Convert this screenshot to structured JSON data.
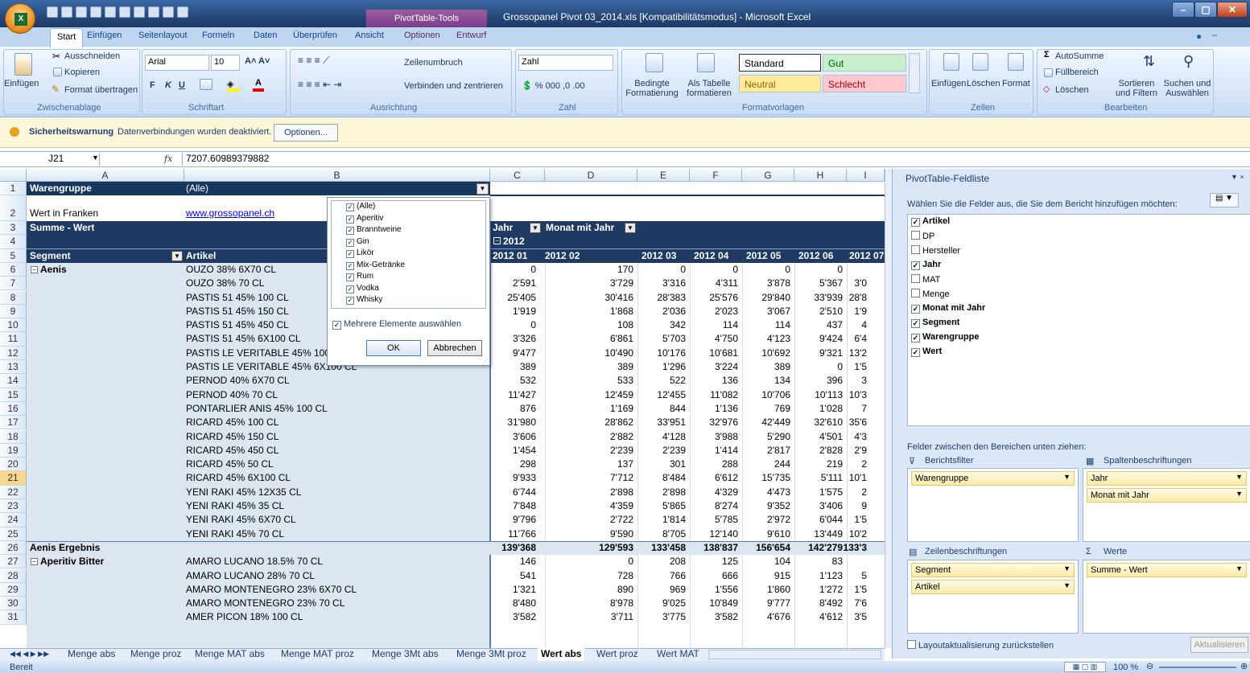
{
  "window": {
    "title": "Grossopanel Pivot 03_2014.xls  [Kompatibilitätsmodus] - Microsoft Excel",
    "context_tab": "PivotTable-Tools"
  },
  "tabs": [
    "Start",
    "Einfügen",
    "Seitenlayout",
    "Formeln",
    "Daten",
    "Überprüfen",
    "Ansicht",
    "Optionen",
    "Entwurf"
  ],
  "ribbon": {
    "clipboard": {
      "paste": "Einfügen",
      "cut": "Ausschneiden",
      "copy": "Kopieren",
      "format_painter": "Format übertragen",
      "label": "Zwischenablage"
    },
    "font": {
      "name": "Arial",
      "size": "10",
      "label": "Schriftart"
    },
    "alignment": {
      "wrap": "Zeilenumbruch",
      "merge": "Verbinden und zentrieren",
      "label": "Ausrichtung"
    },
    "number": {
      "format": "Zahl",
      "label": "Zahl"
    },
    "styles": {
      "conditional": "Bedingte Formatierung",
      "as_table": "Als Tabelle formatieren",
      "standard": "Standard",
      "good": "Gut",
      "neutral": "Neutral",
      "bad": "Schlecht",
      "label": "Formatvorlagen"
    },
    "cells": {
      "insert": "Einfügen",
      "delete": "Löschen",
      "format": "Format",
      "label": "Zellen"
    },
    "editing": {
      "autosum": "AutoSumme",
      "fill": "Füllbereich",
      "clear": "Löschen",
      "sort": "Sortieren und Filtern",
      "find": "Suchen und Auswählen",
      "label": "Bearbeiten"
    }
  },
  "security": {
    "title": "Sicherheitswarnung",
    "text": "Datenverbindungen wurden deaktiviert.",
    "button": "Optionen..."
  },
  "formula_bar": {
    "cell_ref": "J21",
    "fx": "fx",
    "value": "7207.60989379882"
  },
  "columns": [
    "A",
    "B",
    "C",
    "D",
    "E",
    "F",
    "G",
    "H",
    "I"
  ],
  "header_rows": {
    "r1": {
      "a": "Warengruppe",
      "b": "(Alle)"
    },
    "r2": {
      "a": "Wert in Franken",
      "b": "www.grossopanel.ch"
    },
    "r3": {
      "a": "Summe - Wert",
      "c": "Jahr",
      "d": "Monat mit Jahr"
    },
    "r4": {
      "c": "2012"
    },
    "r5": {
      "a": "Segment",
      "b": "Artikel",
      "months": [
        "2012 01",
        "2012 02",
        "2012 03",
        "2012 04",
        "2012 05",
        "2012 06",
        "2012 07"
      ]
    }
  },
  "rows": [
    {
      "n": "6",
      "seg": "Aenis",
      "art": "OUZO 38% 6X70 CL",
      "v": [
        "0",
        "170",
        "0",
        "0",
        "0",
        "0",
        ""
      ]
    },
    {
      "n": "7",
      "seg": "",
      "art": "OUZO 38% 70 CL",
      "v": [
        "2'591",
        "3'729",
        "3'316",
        "4'311",
        "3'878",
        "5'367",
        "3'0"
      ]
    },
    {
      "n": "8",
      "seg": "",
      "art": "PASTIS 51 45% 100 CL",
      "v": [
        "25'405",
        "30'416",
        "28'383",
        "25'576",
        "29'840",
        "33'939",
        "28'8"
      ]
    },
    {
      "n": "9",
      "seg": "",
      "art": "PASTIS 51 45% 150 CL",
      "v": [
        "1'919",
        "1'868",
        "2'036",
        "2'023",
        "3'067",
        "2'510",
        "1'9"
      ]
    },
    {
      "n": "10",
      "seg": "",
      "art": "PASTIS 51 45% 450 CL",
      "v": [
        "0",
        "108",
        "342",
        "114",
        "114",
        "437",
        "4"
      ]
    },
    {
      "n": "11",
      "seg": "",
      "art": "PASTIS 51 45% 6X100 CL",
      "v": [
        "3'326",
        "6'861",
        "5'703",
        "4'750",
        "4'123",
        "9'424",
        "6'4"
      ]
    },
    {
      "n": "12",
      "seg": "",
      "art": "PASTIS LE VERITABLE 45% 100 CL",
      "v": [
        "9'477",
        "10'490",
        "10'176",
        "10'681",
        "10'692",
        "9'321",
        "13'2"
      ]
    },
    {
      "n": "13",
      "seg": "",
      "art": "PASTIS LE VERITABLE 45% 6X100 CL",
      "v": [
        "389",
        "389",
        "1'296",
        "3'224",
        "389",
        "0",
        "1'5"
      ]
    },
    {
      "n": "14",
      "seg": "",
      "art": "PERNOD 40% 6X70 CL",
      "v": [
        "532",
        "533",
        "522",
        "136",
        "134",
        "396",
        "3"
      ]
    },
    {
      "n": "15",
      "seg": "",
      "art": "PERNOD 40% 70 CL",
      "v": [
        "11'427",
        "12'459",
        "12'455",
        "11'082",
        "10'706",
        "10'113",
        "10'3"
      ]
    },
    {
      "n": "16",
      "seg": "",
      "art": "PONTARLIER ANIS 45% 100 CL",
      "v": [
        "876",
        "1'169",
        "844",
        "1'136",
        "769",
        "1'028",
        "7"
      ]
    },
    {
      "n": "17",
      "seg": "",
      "art": "RICARD 45% 100 CL",
      "v": [
        "31'980",
        "28'862",
        "33'951",
        "32'976",
        "42'449",
        "32'610",
        "35'6"
      ]
    },
    {
      "n": "18",
      "seg": "",
      "art": "RICARD 45% 150 CL",
      "v": [
        "3'606",
        "2'882",
        "4'128",
        "3'988",
        "5'290",
        "4'501",
        "4'3"
      ]
    },
    {
      "n": "19",
      "seg": "",
      "art": "RICARD 45% 450 CL",
      "v": [
        "1'454",
        "2'239",
        "2'239",
        "1'414",
        "2'817",
        "2'828",
        "2'9"
      ]
    },
    {
      "n": "20",
      "seg": "",
      "art": "RICARD 45% 50 CL",
      "v": [
        "298",
        "137",
        "301",
        "288",
        "244",
        "219",
        "2"
      ]
    },
    {
      "n": "21",
      "seg": "",
      "art": "RICARD 45% 6X100 CL",
      "v": [
        "9'933",
        "7'712",
        "8'484",
        "6'612",
        "15'735",
        "5'111",
        "10'1"
      ]
    },
    {
      "n": "22",
      "seg": "",
      "art": "YENI RAKI 45% 12X35 CL",
      "v": [
        "6'744",
        "2'898",
        "2'898",
        "4'329",
        "4'473",
        "1'575",
        "2"
      ]
    },
    {
      "n": "23",
      "seg": "",
      "art": "YENI RAKI 45% 35 CL",
      "v": [
        "7'848",
        "4'359",
        "5'865",
        "8'274",
        "9'352",
        "3'406",
        "9"
      ]
    },
    {
      "n": "24",
      "seg": "",
      "art": "YENI RAKI 45% 6X70 CL",
      "v": [
        "9'796",
        "2'722",
        "1'814",
        "5'785",
        "2'972",
        "6'044",
        "1'5"
      ]
    },
    {
      "n": "25",
      "seg": "",
      "art": "YENI RAKI 45% 70 CL",
      "v": [
        "11'766",
        "9'590",
        "8'705",
        "12'140",
        "9'610",
        "13'449",
        "10'2"
      ]
    },
    {
      "n": "26",
      "seg": "Aenis Ergebnis",
      "art": "",
      "v": [
        "139'368",
        "129'593",
        "133'458",
        "138'837",
        "156'654",
        "142'279",
        "133'3"
      ],
      "total": true
    },
    {
      "n": "27",
      "seg": "Aperitiv Bitter",
      "art": "AMARO LUCANO 18.5% 70 CL",
      "v": [
        "146",
        "0",
        "208",
        "125",
        "104",
        "83",
        ""
      ]
    },
    {
      "n": "28",
      "seg": "",
      "art": "AMARO LUCANO 28% 70 CL",
      "v": [
        "541",
        "728",
        "766",
        "666",
        "915",
        "1'123",
        "5"
      ]
    },
    {
      "n": "29",
      "seg": "",
      "art": "AMARO MONTENEGRO 23% 6X70 CL",
      "v": [
        "1'321",
        "890",
        "969",
        "1'556",
        "1'860",
        "1'272",
        "1'5"
      ]
    },
    {
      "n": "30",
      "seg": "",
      "art": "AMARO MONTENEGRO 23% 70 CL",
      "v": [
        "8'480",
        "8'978",
        "9'025",
        "10'849",
        "9'777",
        "8'492",
        "7'6"
      ]
    },
    {
      "n": "31",
      "seg": "",
      "art": "AMER PICON 18% 100 CL",
      "v": [
        "3'582",
        "3'711",
        "3'775",
        "3'582",
        "4'676",
        "4'612",
        "3'5"
      ]
    }
  ],
  "filter_dropdown": {
    "items": [
      "(Alle)",
      "Aperitiv",
      "Branntweine",
      "Gin",
      "Likör",
      "Mix-Getränke",
      "Rum",
      "Vodka",
      "Whisky"
    ],
    "multi": "Mehrere Elemente auswählen",
    "ok": "OK",
    "cancel": "Abbrechen"
  },
  "pivot_pane": {
    "title": "PivotTable-Feldliste",
    "prompt": "Wählen Sie die Felder aus, die Sie dem Bericht hinzufügen möchten:",
    "fields": [
      {
        "name": "Artikel",
        "checked": true
      },
      {
        "name": "DP",
        "checked": false
      },
      {
        "name": "Hersteller",
        "checked": false
      },
      {
        "name": "Jahr",
        "checked": true
      },
      {
        "name": "MAT",
        "checked": false
      },
      {
        "name": "Menge",
        "checked": false
      },
      {
        "name": "Monat mit Jahr",
        "checked": true
      },
      {
        "name": "Segment",
        "checked": true
      },
      {
        "name": "Warengruppe",
        "checked": true
      },
      {
        "name": "Wert",
        "checked": true
      }
    ],
    "drag_text": "Felder zwischen den Bereichen unten ziehen:",
    "report_filter": "Berichtsfilter",
    "column_labels": "Spaltenbeschriftungen",
    "row_labels": "Zeilenbeschriftungen",
    "values": "Werte",
    "filter_items": [
      "Warengruppe"
    ],
    "column_items": [
      "Jahr",
      "Monat mit Jahr"
    ],
    "row_items": [
      "Segment",
      "Artikel"
    ],
    "value_items": [
      "Summe - Wert"
    ],
    "defer": "Layoutaktualisierung zurückstellen",
    "update": "Aktualisieren"
  },
  "sheet_tabs": [
    "Menge abs",
    "Menge proz",
    "Menge MAT abs",
    "Menge MAT proz",
    "Menge 3Mt abs",
    "Menge 3Mt proz",
    "Wert abs",
    "Wert proz",
    "Wert MAT a"
  ],
  "active_sheet": "Wert abs",
  "status": {
    "ready": "Bereit",
    "zoom": "100 %"
  }
}
